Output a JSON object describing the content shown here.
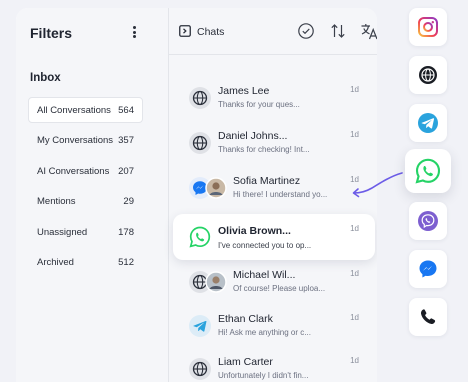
{
  "filters": {
    "title": "Filters",
    "inbox_label": "Inbox",
    "items": [
      {
        "label": "All Conversations",
        "count": "564"
      },
      {
        "label": "My Conversations",
        "count": "357"
      },
      {
        "label": "AI Conversations",
        "count": "207"
      },
      {
        "label": "Mentions",
        "count": "29"
      },
      {
        "label": "Unassigned",
        "count": "178"
      },
      {
        "label": "Archived",
        "count": "512"
      }
    ]
  },
  "chats": {
    "title": "Chats",
    "items": [
      {
        "name": "James Lee",
        "preview": "Thanks for your ques...",
        "time": "1d",
        "channel": "web"
      },
      {
        "name": "Daniel Johns...",
        "preview": "Thanks for checking! Int...",
        "time": "1d",
        "channel": "web"
      },
      {
        "name": "Sofia Martinez",
        "preview": "Hi there! I understand yo...",
        "time": "1d",
        "channel": "messenger"
      },
      {
        "name": "Olivia Brown...",
        "preview": "I've connected you to op...",
        "time": "1d",
        "channel": "whatsapp"
      },
      {
        "name": "Michael Wil...",
        "preview": "Of course! Please uploa...",
        "time": "1d",
        "channel": "web"
      },
      {
        "name": "Ethan Clark",
        "preview": "Hi! Ask me anything or c...",
        "time": "1d",
        "channel": "telegram"
      },
      {
        "name": "Liam Carter",
        "preview": "Unfortunately I didn't fin...",
        "time": "1d",
        "channel": "web"
      }
    ]
  },
  "channels": [
    "instagram-icon",
    "web-icon",
    "telegram-icon",
    "whatsapp-icon",
    "viber-icon",
    "messenger-icon",
    "phone-icon"
  ],
  "colors": {
    "whatsapp": "#25d366",
    "telegram": "#2aa3dd",
    "viber": "#7d5fd0",
    "messenger": "#1877f2",
    "arrow": "#6c5ce7"
  }
}
